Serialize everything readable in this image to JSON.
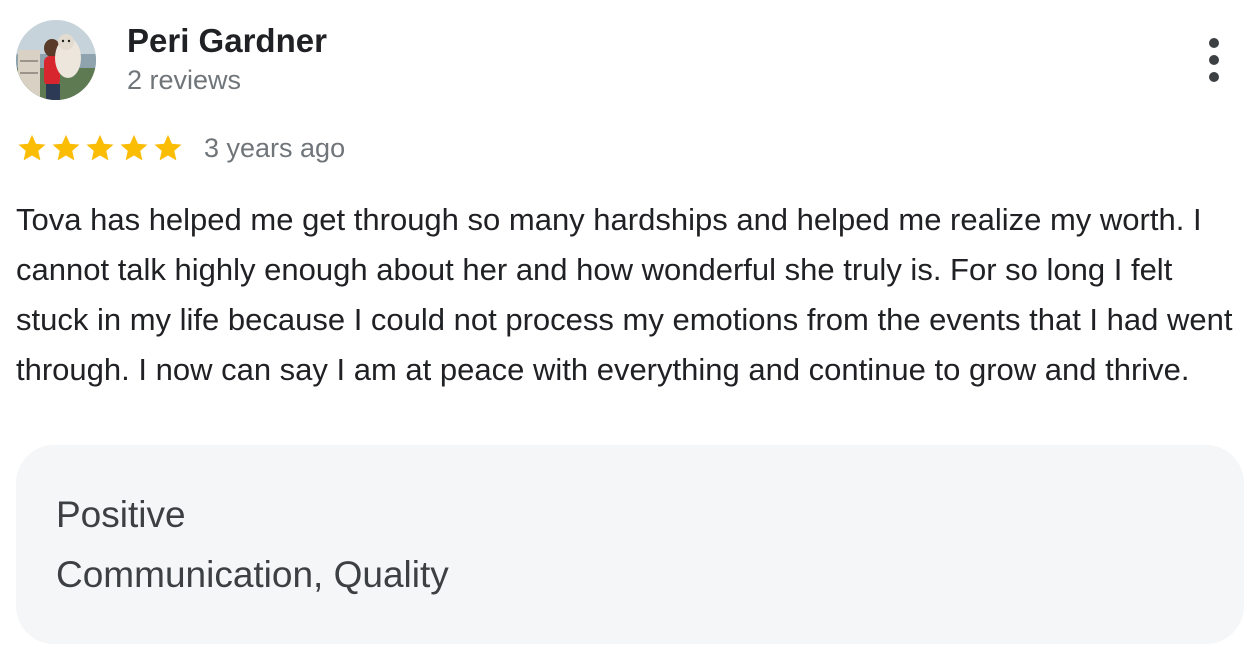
{
  "review": {
    "author": {
      "name": "Peri Gardner",
      "subtitle": "2 reviews",
      "avatar_icon": "profile-photo"
    },
    "more_icon": "more-vert-icon",
    "rating": {
      "stars": 5,
      "max_stars": 5,
      "star_color": "#fbbc04",
      "time": "3 years ago"
    },
    "text": "Tova has helped me get through so many hardships and helped me realize my worth. I cannot talk highly enough about her and how wonderful she truly is. For so long I felt stuck in my life because I could not process my emotions from the events that I had went through. I now can say I am at peace with everything and continue to grow and thrive.",
    "attributes": {
      "title": "Positive",
      "value": "Communication, Quality"
    }
  }
}
